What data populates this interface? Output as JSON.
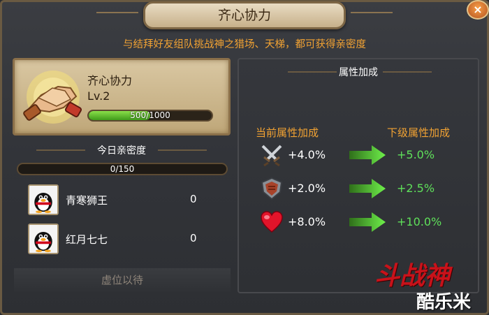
{
  "window": {
    "title": "齐心协力",
    "close_label": "×"
  },
  "subtitle": "与结拜好友组队挑战神之猎场、天梯，都可获得亲密度",
  "skill": {
    "name": "齐心协力",
    "level": "Lv.2",
    "xp_text": "500/1000",
    "xp_fraction": 0.5,
    "icon": "handshake-icon"
  },
  "today": {
    "label": "今日亲密度",
    "progress_text": "0/150",
    "progress_fraction": 0
  },
  "friends": [
    {
      "name": "青寒狮王",
      "value": "0",
      "avatar": "qq-penguin-avatar"
    },
    {
      "name": "红月七七",
      "value": "0",
      "avatar": "qq-penguin-avatar"
    }
  ],
  "vacant_label": "虚位以待",
  "attributes": {
    "title": "属性加成",
    "current_header": "当前属性加成",
    "next_header": "下级属性加成",
    "rows": [
      {
        "icon": "crossed-swords-icon",
        "current": "+4.0%",
        "next": "+5.0%"
      },
      {
        "icon": "shield-icon",
        "current": "+2.0%",
        "next": "+2.5%"
      },
      {
        "icon": "heart-icon",
        "current": "+8.0%",
        "next": "+10.0%"
      }
    ]
  },
  "colors": {
    "accent_orange": "#f1a233",
    "next_value_green": "#5fe05a",
    "progress_green": "#6cc832"
  },
  "watermark": {
    "logo": "斗战神",
    "site": "酷乐米"
  }
}
